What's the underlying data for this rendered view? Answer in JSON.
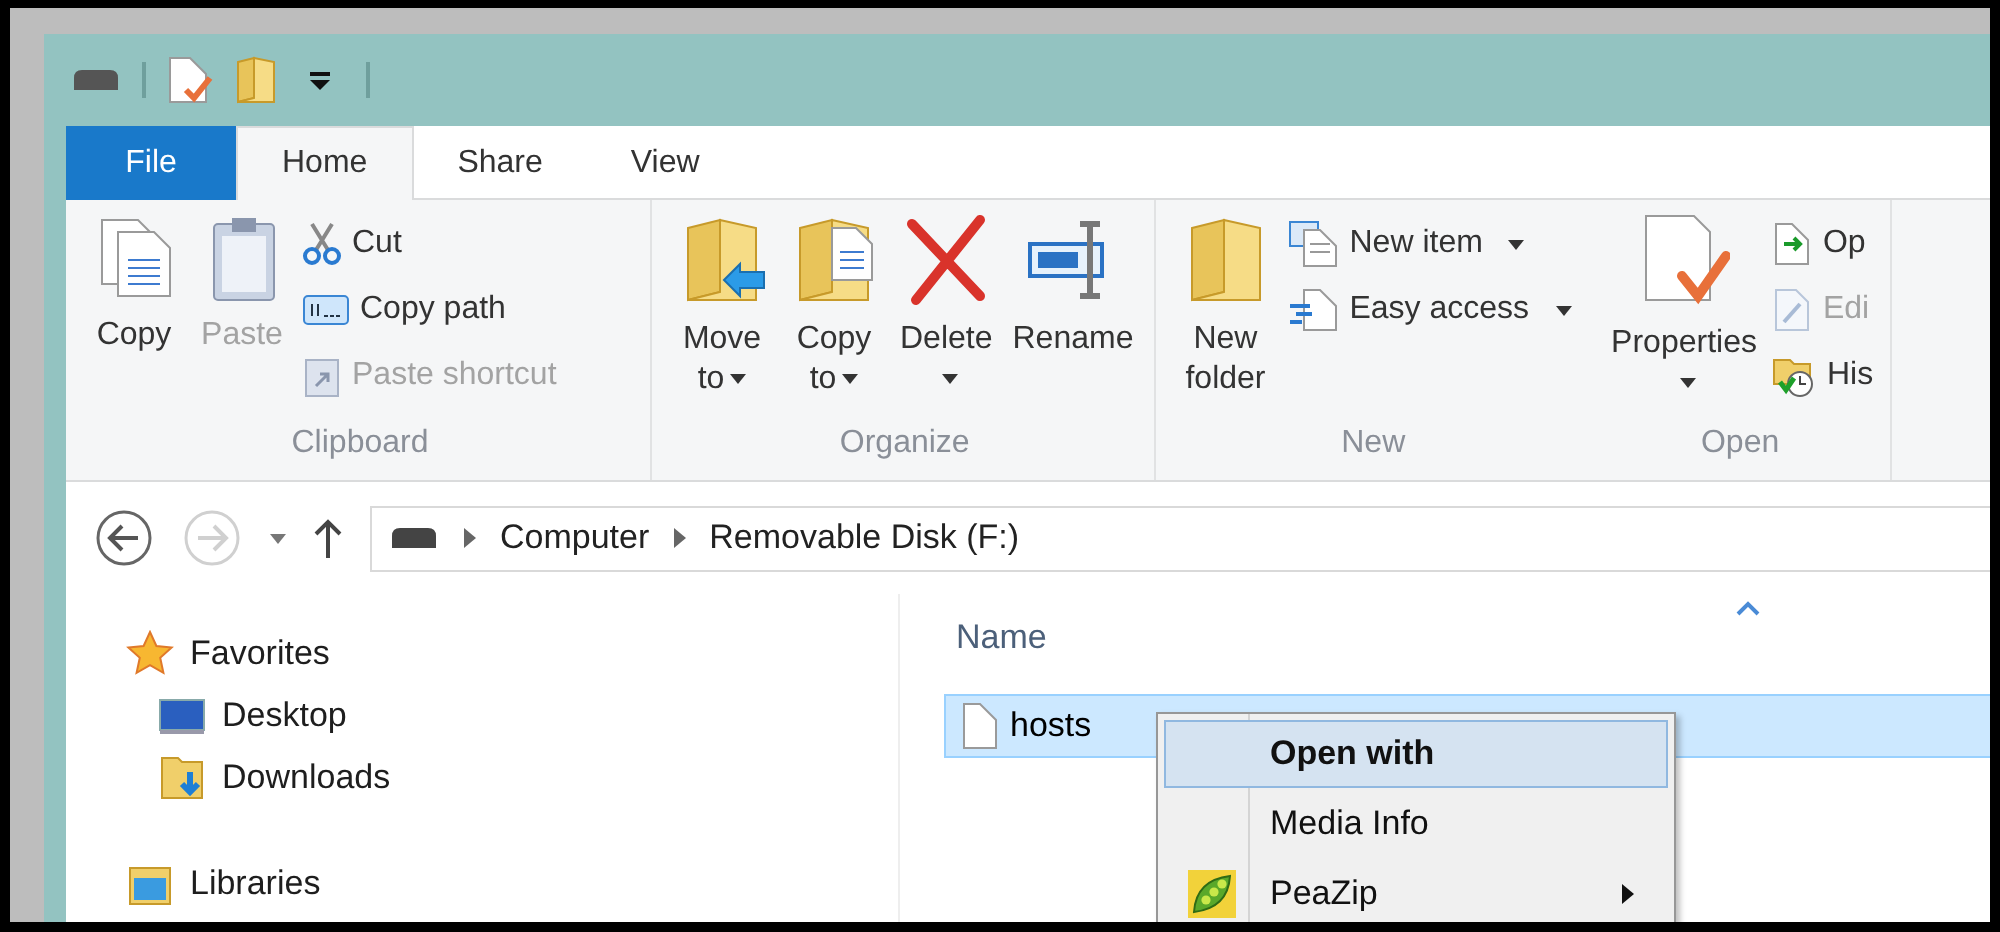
{
  "ribbon_tabs": [
    {
      "label": "File",
      "kind": "file",
      "selected": false
    },
    {
      "label": "Home",
      "kind": "tab",
      "selected": true
    },
    {
      "label": "Share",
      "kind": "tab",
      "selected": false
    },
    {
      "label": "View",
      "kind": "tab",
      "selected": false
    }
  ],
  "ribbon_groups": [
    {
      "label": "Clipboard",
      "commands": [
        {
          "label": "Copy",
          "kind": "large",
          "disabled": false,
          "dropdown": false
        },
        {
          "label": "Paste",
          "kind": "large",
          "disabled": true,
          "dropdown": false
        },
        {
          "label": "Cut",
          "kind": "small",
          "disabled": false,
          "dropdown": false
        },
        {
          "label": "Copy path",
          "kind": "small",
          "disabled": false,
          "dropdown": false
        },
        {
          "label": "Paste shortcut",
          "kind": "small",
          "disabled": true,
          "dropdown": false
        }
      ]
    },
    {
      "label": "Organize",
      "commands": [
        {
          "label": "Move to",
          "kind": "large",
          "disabled": false,
          "dropdown": true
        },
        {
          "label": "Copy to",
          "kind": "large",
          "disabled": false,
          "dropdown": true
        },
        {
          "label": "Delete",
          "kind": "large",
          "disabled": false,
          "dropdown": true
        },
        {
          "label": "Rename",
          "kind": "large",
          "disabled": false,
          "dropdown": false
        }
      ]
    },
    {
      "label": "New",
      "commands": [
        {
          "label": "New folder",
          "kind": "large",
          "disabled": false,
          "dropdown": false
        },
        {
          "label": "New item",
          "kind": "small",
          "disabled": false,
          "dropdown": true
        },
        {
          "label": "Easy access",
          "kind": "small",
          "disabled": false,
          "dropdown": true
        }
      ]
    },
    {
      "label": "Open",
      "commands": [
        {
          "label": "Properties",
          "kind": "large",
          "disabled": false,
          "dropdown": true
        },
        {
          "label": "Op",
          "kind": "small",
          "disabled": false,
          "dropdown": false
        },
        {
          "label": "Edi",
          "kind": "small",
          "disabled": true,
          "dropdown": false
        },
        {
          "label": "His",
          "kind": "small",
          "disabled": false,
          "dropdown": false
        }
      ]
    }
  ],
  "navigation": {
    "back_disabled": false,
    "forward_disabled": true
  },
  "address_bar": {
    "segments": [
      "Computer",
      "Removable Disk (F:)"
    ]
  },
  "navigation_pane": [
    {
      "label": "Favorites",
      "children": [
        {
          "label": "Desktop"
        },
        {
          "label": "Downloads"
        }
      ]
    },
    {
      "label": "Libraries"
    }
  ],
  "file_list": {
    "columns": [
      "Name"
    ],
    "rows": [
      {
        "name": "hosts",
        "selected": true
      }
    ]
  },
  "context_menu": [
    {
      "label": "Open with",
      "default": true,
      "selected": true,
      "submenu": false
    },
    {
      "label": "Media Info",
      "default": false,
      "selected": false,
      "submenu": false
    },
    {
      "label": "PeaZip",
      "default": false,
      "selected": false,
      "submenu": true
    }
  ]
}
